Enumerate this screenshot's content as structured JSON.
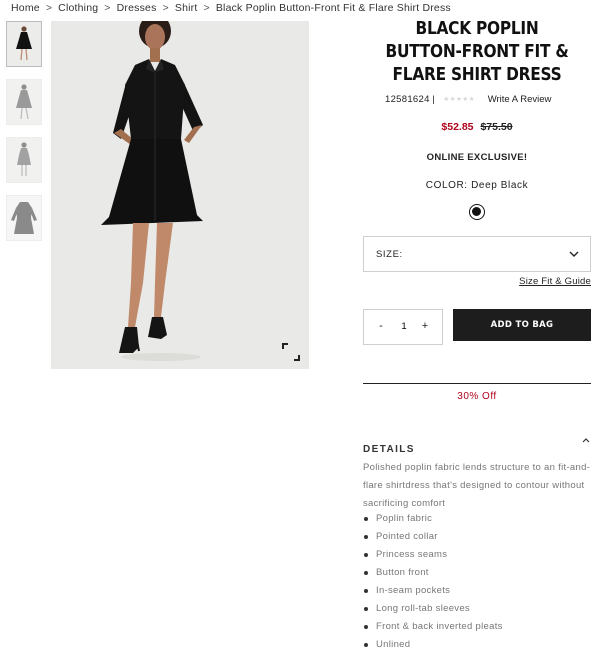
{
  "breadcrumb": {
    "items": [
      "Home",
      "Clothing",
      "Dresses",
      "Shirt",
      "Black Poplin Button-Front Fit & Flare Shirt Dress"
    ],
    "separator": ">"
  },
  "product": {
    "title": "BLACK POPLIN BUTTON-FRONT FIT & FLARE SHIRT DRESS",
    "sku": "12581624",
    "sku_divider": "|",
    "stars": "★★★★★",
    "review_link": "Write A Review",
    "sale_price": "$52.85",
    "original_price": "$75.50",
    "exclusive": "ONLINE EXCLUSIVE!",
    "color_label": "COLOR:",
    "color_value": "Deep Black",
    "swatch_color": "#111111"
  },
  "size": {
    "label": "SIZE:",
    "guide_link": "Size Fit & Guide"
  },
  "cart": {
    "minus": "-",
    "quantity": "1",
    "plus": "+",
    "add_label": "ADD TO BAG"
  },
  "promo": "30% Off",
  "details": {
    "heading": "DETAILS",
    "description": "Polished poplin fabric lends structure to an fit-and-flare shirtdress that's designed to contour without sacrificing comfort",
    "features": [
      "Poplin fabric",
      "Pointed collar",
      "Princess seams",
      "Button front",
      "In-seam pockets",
      "Long roll-tab sleeves",
      "Front & back inverted pleats",
      "Unlined"
    ]
  },
  "icons": {
    "expand": "expand-icon",
    "size_chevron": "chevron-down-icon",
    "details_caret": "chevron-up-icon"
  },
  "colors": {
    "sale": "#b0021b",
    "button": "#1d1d1d",
    "image_bg": "#e9e9e7"
  }
}
